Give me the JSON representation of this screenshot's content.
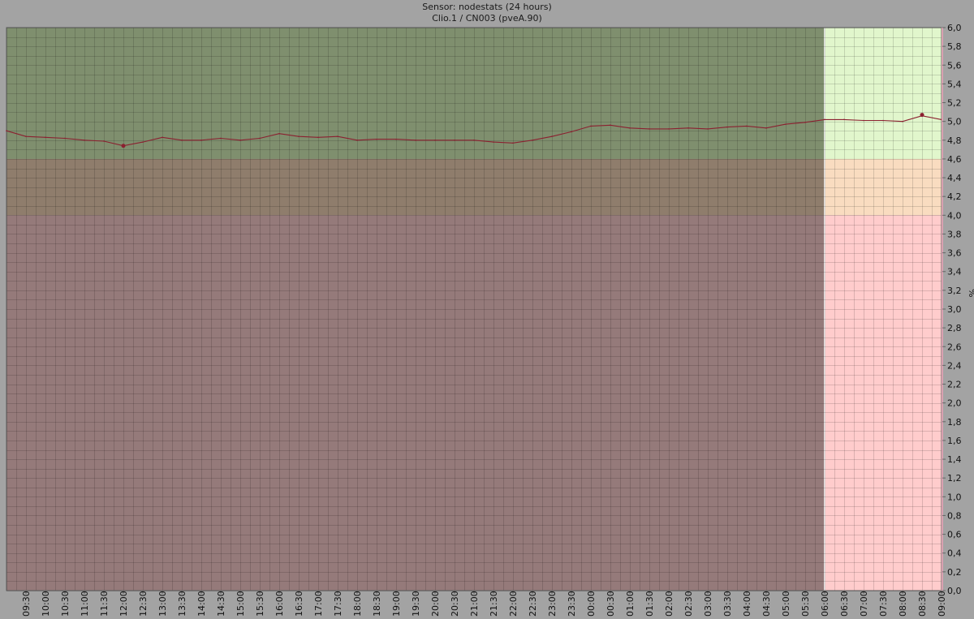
{
  "header": {
    "title": "Sensor: nodestats (24 hours)",
    "subtitle": "Clio.1 / CN003 (pveA.90)"
  },
  "colors": {
    "zone_good_shaded": "#7f8f6e",
    "zone_warn_shaded": "#8f7d6c",
    "zone_bad_shaded": "#957a7a",
    "zone_good_live": "#e1f6cc",
    "zone_warn_live": "#f9dcc0",
    "zone_bad_live": "#ffcccc",
    "line": "#8b2030",
    "axis_accent": "#d9a0b0"
  },
  "chart_data": {
    "type": "line",
    "title": "Sensor: nodestats (24 hours)",
    "subtitle": "Clio.1 / CN003 (pveA.90)",
    "xlabel": "",
    "ylabel": "%",
    "ylim": [
      0,
      6.0
    ],
    "y_ticks": [
      "0,0",
      "0,2",
      "0,4",
      "0,6",
      "0,8",
      "1,0",
      "1,2",
      "1,4",
      "1,6",
      "1,8",
      "2,0",
      "2,2",
      "2,4",
      "2,6",
      "2,8",
      "3,0",
      "3,2",
      "3,4",
      "3,6",
      "3,8",
      "4,0",
      "4,2",
      "4,4",
      "4,6",
      "4,8",
      "5,0",
      "5,2",
      "5,4",
      "5,6",
      "5,8",
      "6,0"
    ],
    "x_ticks": [
      "09:30",
      "10:00",
      "10:30",
      "11:00",
      "11:30",
      "12:00",
      "12:30",
      "13:00",
      "13:30",
      "14:00",
      "14:30",
      "15:00",
      "15:30",
      "16:00",
      "16:30",
      "17:00",
      "17:30",
      "18:00",
      "18:30",
      "19:00",
      "19:30",
      "20:00",
      "20:30",
      "21:00",
      "21:30",
      "22:00",
      "22:30",
      "23:00",
      "23:30",
      "00:00",
      "00:30",
      "01:00",
      "01:30",
      "02:00",
      "02:30",
      "03:00",
      "03:30",
      "04:00",
      "04:30",
      "05:00",
      "05:30",
      "06:00",
      "06:30",
      "07:00",
      "07:30",
      "08:00",
      "08:30",
      "09:00"
    ],
    "x_start": "09:00",
    "x_end": "09:00",
    "zones": [
      {
        "name": "good",
        "from": 4.6,
        "to": 6.0
      },
      {
        "name": "warning",
        "from": 4.0,
        "to": 4.6
      },
      {
        "name": "error",
        "from": 0.0,
        "to": 4.0
      }
    ],
    "highlight_from": "06:00",
    "grid": true,
    "series": [
      {
        "x": [
          "09:00",
          "09:30",
          "10:00",
          "10:30",
          "11:00",
          "11:30",
          "12:00",
          "12:30",
          "13:00",
          "13:30",
          "14:00",
          "14:30",
          "15:00",
          "15:30",
          "16:00",
          "16:30",
          "17:00",
          "17:30",
          "18:00",
          "18:30",
          "19:00",
          "19:30",
          "20:00",
          "20:30",
          "21:00",
          "21:30",
          "22:00",
          "22:30",
          "23:00",
          "23:30",
          "00:00",
          "00:30",
          "01:00",
          "01:30",
          "02:00",
          "02:30",
          "03:00",
          "03:30",
          "04:00",
          "04:30",
          "05:00",
          "05:30",
          "06:00",
          "06:30",
          "07:00",
          "07:30",
          "08:00",
          "08:30",
          "09:00"
        ],
        "values": [
          4.9,
          4.84,
          4.83,
          4.82,
          4.8,
          4.79,
          4.74,
          4.78,
          4.83,
          4.8,
          4.8,
          4.82,
          4.8,
          4.82,
          4.87,
          4.84,
          4.83,
          4.84,
          4.8,
          4.81,
          4.81,
          4.8,
          4.8,
          4.8,
          4.8,
          4.78,
          4.77,
          4.8,
          4.84,
          4.89,
          4.95,
          4.96,
          4.93,
          4.92,
          4.92,
          4.93,
          4.92,
          4.94,
          4.95,
          4.93,
          4.97,
          4.99,
          5.02,
          5.02,
          5.01,
          5.01,
          5.0,
          5.06,
          5.02
        ],
        "min_point": {
          "x": "12:00",
          "y": 4.74
        },
        "max_point": {
          "x": "08:30",
          "y": 5.07
        }
      }
    ]
  }
}
